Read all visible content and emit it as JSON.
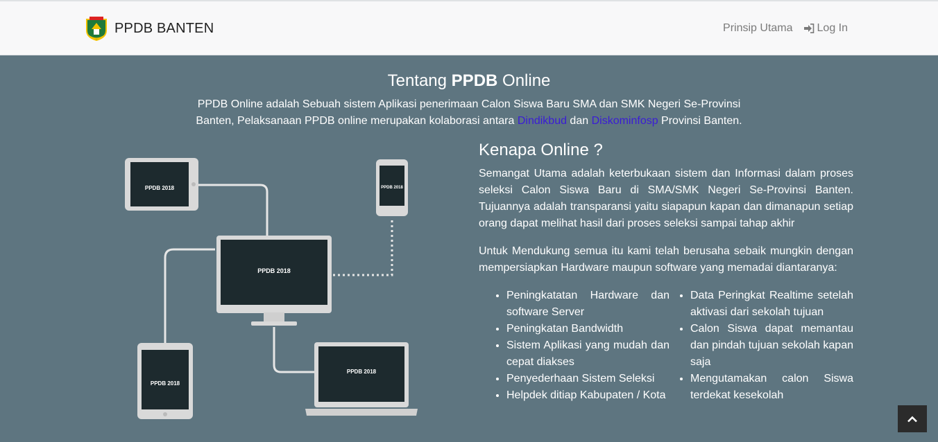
{
  "navbar": {
    "brand": "PPDB BANTEN",
    "links": [
      {
        "label": "Prinsip Utama"
      },
      {
        "label": "Log In",
        "icon": "sign-in-icon"
      }
    ]
  },
  "hero": {
    "title_pre": "Tentang ",
    "title_bold": "PPDB",
    "title_post": " Online",
    "desc_1": "PPDB Online adalah Sebuah sistem Aplikasi penerimaan Calon Siswa Baru SMA dan SMK Negeri Se-Provinsi Banten, Pelaksanaan PPDB online merupakan kolaborasi antara ",
    "link_1": "Dindikbud",
    "desc_2": " dan ",
    "link_2": "Diskominfosp",
    "desc_3": " Provinsi Banten."
  },
  "illustration": {
    "screen_title": "PPDB 2018"
  },
  "why": {
    "title": "Kenapa Online ?",
    "p1": "Semangat Utama adalah keterbukaan sistem dan Informasi dalam proses seleksi Calon Siswa Baru di SMA/SMK Negeri Se-Provinsi Banten. Tujuannya adalah transparansi yaitu siapapun kapan dan dimanapun setiap orang dapat melihat hasil dari proses seleksi sampai tahap akhir",
    "p2": "Untuk Mendukung semua itu kami telah berusaha sebaik mungkin dengan mempersiapkan Hardware maupun software yang memadai diantaranya:",
    "list_left": [
      "Peningkatatan Hardware dan software Server",
      "Peningkatan Bandwidth",
      "Sistem Aplikasi yang mudah dan cepat diakses",
      "Penyederhaan Sistem Seleksi",
      "Helpdek ditiap Kabupaten / Kota"
    ],
    "list_right": [
      "Data Peringkat Realtime setelah aktivasi dari sekolah tujuan",
      "Calon Siswa dapat memantau dan pindah tujuan sekolah kapan saja",
      "Mengutamakan calon Siswa terdekat kesekolah"
    ]
  },
  "scroll_top": {
    "icon": "chevron-up-icon"
  }
}
